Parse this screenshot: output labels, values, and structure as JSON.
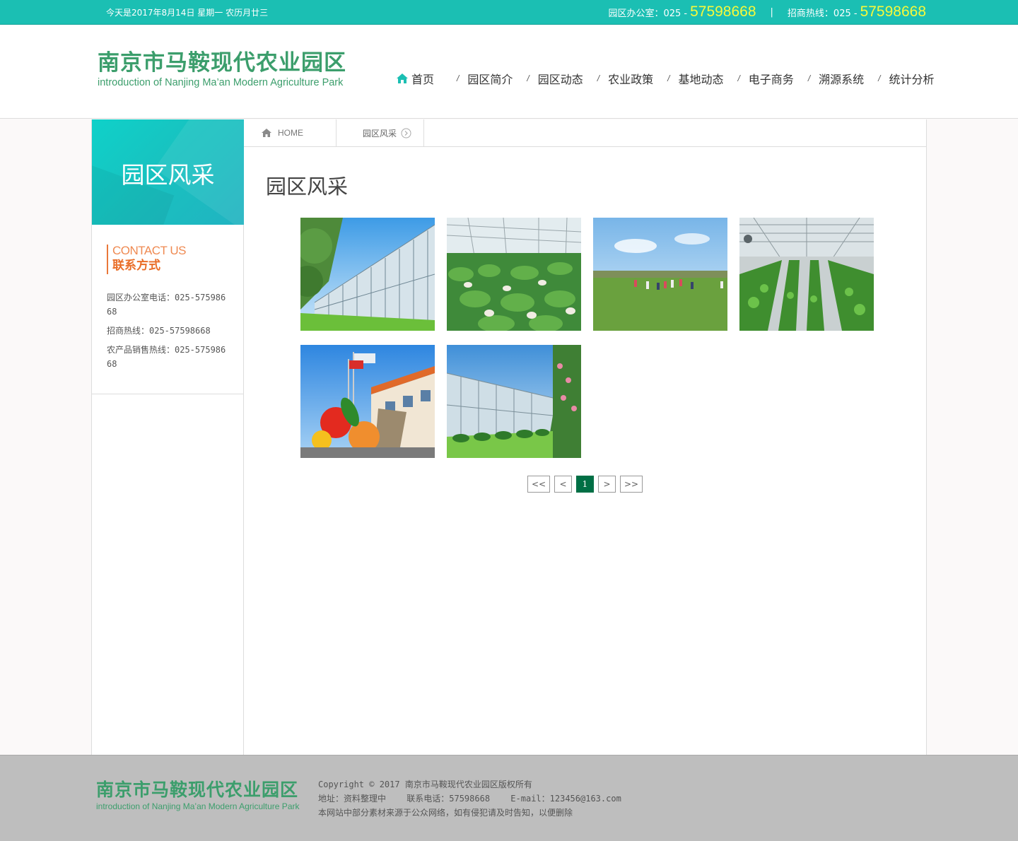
{
  "topbar": {
    "date_text": "今天是2017年8月14日  星期一  农历月廿三",
    "office_label": "园区办公室：025 -",
    "office_number": "57598668",
    "separator": "|",
    "hotline_label": "招商热线：025 -",
    "hotline_number": "57598668"
  },
  "header": {
    "logo_cn": "南京市马鞍现代农业园区",
    "logo_en": "introduction of Nanjing Ma’an Modern Agriculture Park"
  },
  "nav": {
    "items": [
      "首页",
      "园区简介",
      "园区动态",
      "农业政策",
      "基地动态",
      "电子商务",
      "溯源系统",
      "统计分析"
    ],
    "slash": "/"
  },
  "sidebar": {
    "banner_title": "园区风采",
    "contact_en": "CONTACT US",
    "contact_cn": "联系方式",
    "contacts": [
      "园区办公室电话：025-57598668",
      "招商热线：025-57598668",
      "农产品销售热线：025-57598668"
    ]
  },
  "breadcrumb": {
    "home": "HOME",
    "current": "园区风采"
  },
  "main": {
    "title": "园区风采"
  },
  "gallery": {
    "images": [
      "greenhouse-exterior",
      "anthurium-greenhouse",
      "lawn-visitors",
      "seedling-greenhouse",
      "vegetable-sculpture",
      "greenhouse-garden"
    ]
  },
  "pager": {
    "first": "<<",
    "prev": "<",
    "current": "1",
    "next": ">",
    "last": ">>"
  },
  "footer": {
    "logo_cn": "南京市马鞍现代农业园区",
    "logo_en": "introduction of Nanjing Ma’an Modern Agriculture Park",
    "copyright": "Copyright © 2017 南京市马鞍现代农业园区版权所有",
    "address": "地址：资料整理中",
    "phone": "联系电话：57598668",
    "email": "E-mail：123456@163.com",
    "notice": "本网站中部分素材来源于公众网络，如有侵犯请及时告知，以便删除"
  },
  "colors": {
    "topbar": "#1bbfb3",
    "brand_green": "#3c9e6c",
    "phone_yellow": "#f7f93a",
    "contact_orange": "#e96d27",
    "pager_active": "#006f45",
    "footer_bg": "#bebebe"
  }
}
